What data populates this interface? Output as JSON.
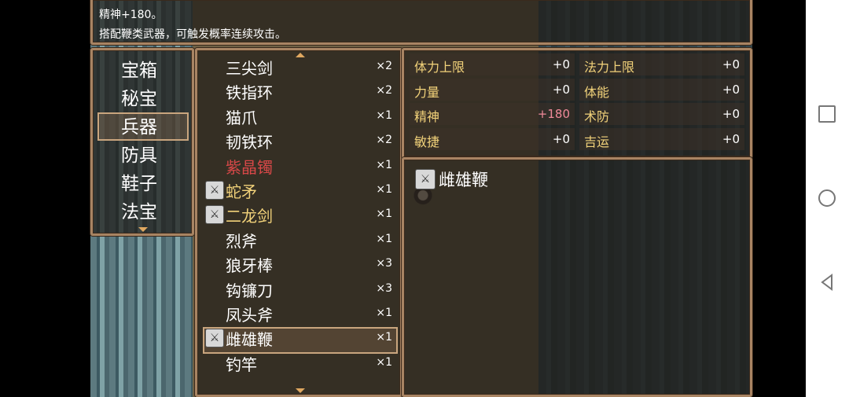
{
  "help": {
    "line1": "精神+180。",
    "line2": "搭配鞭类武器，可触发概率连续攻击。"
  },
  "categories": [
    "宝箱",
    "秘宝",
    "兵器",
    "防具",
    "鞋子",
    "法宝"
  ],
  "selected_category": "兵器",
  "items": [
    {
      "name": "三尖剑",
      "count": "×2",
      "color": "white",
      "icon": false
    },
    {
      "name": "铁指环",
      "count": "×2",
      "color": "white",
      "icon": false
    },
    {
      "name": "猫爪",
      "count": "×1",
      "color": "white",
      "icon": false
    },
    {
      "name": "韧铁环",
      "count": "×2",
      "color": "white",
      "icon": false
    },
    {
      "name": "紫晶镯",
      "count": "×1",
      "color": "red",
      "icon": false
    },
    {
      "name": "蛇矛",
      "count": "×1",
      "color": "gold",
      "icon": true
    },
    {
      "name": "二龙剑",
      "count": "×1",
      "color": "gold",
      "icon": true
    },
    {
      "name": "烈斧",
      "count": "×1",
      "color": "white",
      "icon": false
    },
    {
      "name": "狼牙棒",
      "count": "×3",
      "color": "white",
      "icon": false
    },
    {
      "name": "钩镰刀",
      "count": "×3",
      "color": "white",
      "icon": false
    },
    {
      "name": "凤头斧",
      "count": "×1",
      "color": "white",
      "icon": false
    },
    {
      "name": "雌雄鞭",
      "count": "×1",
      "color": "white",
      "icon": true
    },
    {
      "name": "钓竿",
      "count": "×1",
      "color": "white",
      "icon": false
    }
  ],
  "selected_item": "雌雄鞭",
  "stats": [
    {
      "left_key": "体力上限",
      "left_val": "+0",
      "right_key": "法力上限",
      "right_val": "+0"
    },
    {
      "left_key": "力量",
      "left_val": "+0",
      "right_key": "体能",
      "right_val": "+0"
    },
    {
      "left_key": "精神",
      "left_val": "+180",
      "right_key": "术防",
      "right_val": "+0"
    },
    {
      "left_key": "敏捷",
      "left_val": "+0",
      "right_key": "吉运",
      "right_val": "+0"
    }
  ],
  "detail": {
    "name": "雌雄鞭"
  },
  "colors": {
    "frame": "#a88463",
    "label_gold": "#f2d27a",
    "rare_red": "#d84848",
    "bonus_pink": "#f08a9a"
  },
  "icons": {
    "weapon_icon": "sword-emblem-icon"
  }
}
